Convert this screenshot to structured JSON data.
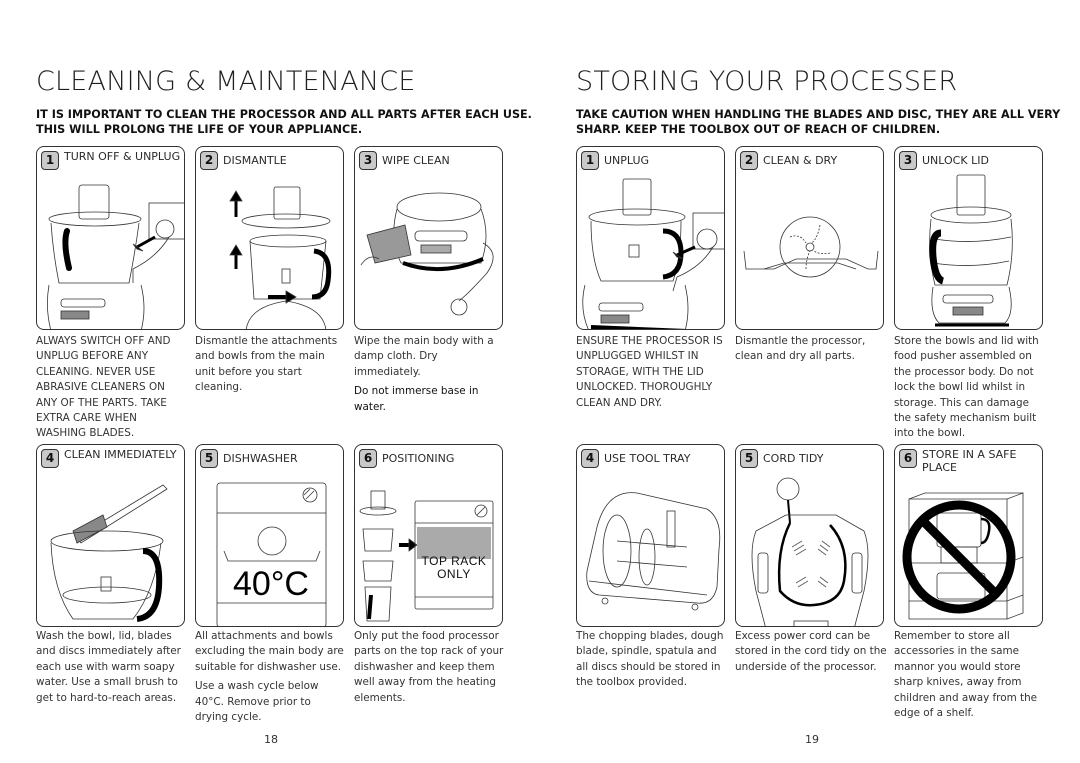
{
  "left_page": {
    "title": "CLEANING & MAINTENANCE",
    "intro": "IT IS IMPORTANT TO CLEAN THE PROCESSOR AND ALL PARTS AFTER EACH USE. THIS WILL PROLONG THE LIFE OF YOUR APPLIANCE.",
    "page_number": "18",
    "steps": [
      {
        "number": "1",
        "label": "TURN OFF & UNPLUG",
        "illustration": "unplug-processor-illustration",
        "description": [
          "ALWAYS SWITCH OFF AND UNPLUG BEFORE ANY CLEANING. NEVER USE ABRASIVE CLEANERS ON ANY OF THE PARTS. TAKE EXTRA CARE WHEN WASHING BLADES."
        ]
      },
      {
        "number": "2",
        "label": "DISMANTLE",
        "illustration": "dismantle-illustration",
        "description": [
          "Dismantle the attachments and bowls from the main unit before you start cleaning."
        ]
      },
      {
        "number": "3",
        "label": "WIPE CLEAN",
        "illustration": "wipe-clean-illustration",
        "description": [
          "Wipe the main body with a damp cloth. Dry immediately.",
          "Do not immerse base in water."
        ]
      },
      {
        "number": "4",
        "label": "CLEAN IMMEDIATELY",
        "illustration": "brush-bowl-illustration",
        "description": [
          "Wash the bowl, lid, blades and discs immediately after each use with warm soapy water. Use a small brush to get to hard-to-reach areas."
        ]
      },
      {
        "number": "5",
        "label": "DISHWASHER",
        "illustration": "dishwasher-illustration",
        "temperature": "40°C",
        "description": [
          "All attachments and bowls excluding the main body are suitable for dishwasher use.",
          "Use a wash cycle below 40°C. Remove prior to drying cycle."
        ]
      },
      {
        "number": "6",
        "label": "POSITIONING",
        "illustration": "top-rack-illustration",
        "rack_label": "TOP RACK ONLY",
        "description": [
          "Only put the food processor parts on the top rack of your dishwasher and keep them well away from the heating elements."
        ]
      }
    ]
  },
  "right_page": {
    "title": "STORING YOUR PROCESSER",
    "intro": "TAKE CAUTION WHEN HANDLING THE BLADES AND DISC, THEY ARE ALL VERY SHARP. KEEP THE TOOLBOX OUT OF REACH OF CHILDREN.",
    "page_number": "19",
    "steps": [
      {
        "number": "1",
        "label": "UNPLUG",
        "illustration": "unplug-processor-illustration",
        "description": [
          "ENSURE THE PROCESSOR IS UNPLUGGED WHILST IN STORAGE, WITH THE LID UNLOCKED. THOROUGHLY CLEAN AND DRY."
        ]
      },
      {
        "number": "2",
        "label": "CLEAN & DRY",
        "illustration": "disc-on-rack-illustration",
        "description": [
          "Dismantle the processor, clean and dry all parts."
        ]
      },
      {
        "number": "3",
        "label": "UNLOCK LID",
        "illustration": "assembled-processor-illustration",
        "description": [
          "Store the bowls and lid with food pusher assembled on the processor body. Do not lock the bowl lid whilst in storage. This can damage the safety mechanism built into the bowl."
        ]
      },
      {
        "number": "4",
        "label": "USE TOOL TRAY",
        "illustration": "toolbox-illustration",
        "description": [
          "The chopping blades, dough blade, spindle, spatula and all discs should be stored in the toolbox provided."
        ]
      },
      {
        "number": "5",
        "label": "CORD TIDY",
        "illustration": "cord-tidy-illustration",
        "description": [
          "Excess power cord can be stored in the cord tidy on the underside of the processor."
        ]
      },
      {
        "number": "6",
        "label": "STORE IN A SAFE PLACE",
        "illustration": "no-shelf-edge-illustration",
        "description": [
          "Remember to store all accessories in the same mannor you would store sharp knives, away from children and away from the edge of a shelf."
        ]
      }
    ]
  }
}
